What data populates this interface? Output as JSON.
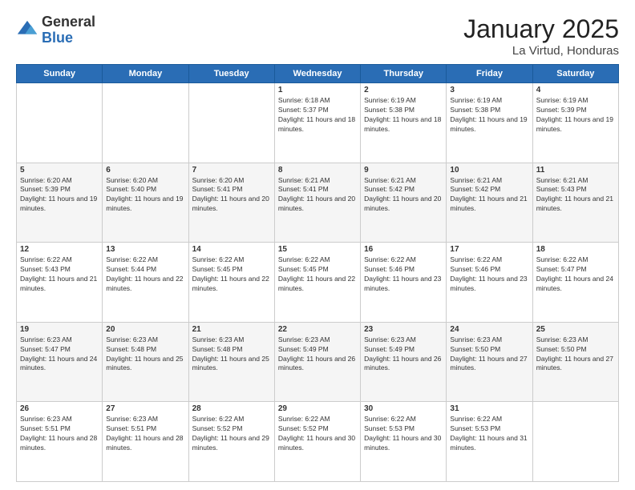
{
  "header": {
    "logo_general": "General",
    "logo_blue": "Blue",
    "month_title": "January 2025",
    "location": "La Virtud, Honduras"
  },
  "weekdays": [
    "Sunday",
    "Monday",
    "Tuesday",
    "Wednesday",
    "Thursday",
    "Friday",
    "Saturday"
  ],
  "weeks": [
    [
      {
        "day": "",
        "sunrise": "",
        "sunset": "",
        "daylight": ""
      },
      {
        "day": "",
        "sunrise": "",
        "sunset": "",
        "daylight": ""
      },
      {
        "day": "",
        "sunrise": "",
        "sunset": "",
        "daylight": ""
      },
      {
        "day": "1",
        "sunrise": "6:18 AM",
        "sunset": "5:37 PM",
        "daylight": "11 hours and 18 minutes."
      },
      {
        "day": "2",
        "sunrise": "6:19 AM",
        "sunset": "5:38 PM",
        "daylight": "11 hours and 18 minutes."
      },
      {
        "day": "3",
        "sunrise": "6:19 AM",
        "sunset": "5:38 PM",
        "daylight": "11 hours and 19 minutes."
      },
      {
        "day": "4",
        "sunrise": "6:19 AM",
        "sunset": "5:39 PM",
        "daylight": "11 hours and 19 minutes."
      }
    ],
    [
      {
        "day": "5",
        "sunrise": "6:20 AM",
        "sunset": "5:39 PM",
        "daylight": "11 hours and 19 minutes."
      },
      {
        "day": "6",
        "sunrise": "6:20 AM",
        "sunset": "5:40 PM",
        "daylight": "11 hours and 19 minutes."
      },
      {
        "day": "7",
        "sunrise": "6:20 AM",
        "sunset": "5:41 PM",
        "daylight": "11 hours and 20 minutes."
      },
      {
        "day": "8",
        "sunrise": "6:21 AM",
        "sunset": "5:41 PM",
        "daylight": "11 hours and 20 minutes."
      },
      {
        "day": "9",
        "sunrise": "6:21 AM",
        "sunset": "5:42 PM",
        "daylight": "11 hours and 20 minutes."
      },
      {
        "day": "10",
        "sunrise": "6:21 AM",
        "sunset": "5:42 PM",
        "daylight": "11 hours and 21 minutes."
      },
      {
        "day": "11",
        "sunrise": "6:21 AM",
        "sunset": "5:43 PM",
        "daylight": "11 hours and 21 minutes."
      }
    ],
    [
      {
        "day": "12",
        "sunrise": "6:22 AM",
        "sunset": "5:43 PM",
        "daylight": "11 hours and 21 minutes."
      },
      {
        "day": "13",
        "sunrise": "6:22 AM",
        "sunset": "5:44 PM",
        "daylight": "11 hours and 22 minutes."
      },
      {
        "day": "14",
        "sunrise": "6:22 AM",
        "sunset": "5:45 PM",
        "daylight": "11 hours and 22 minutes."
      },
      {
        "day": "15",
        "sunrise": "6:22 AM",
        "sunset": "5:45 PM",
        "daylight": "11 hours and 22 minutes."
      },
      {
        "day": "16",
        "sunrise": "6:22 AM",
        "sunset": "5:46 PM",
        "daylight": "11 hours and 23 minutes."
      },
      {
        "day": "17",
        "sunrise": "6:22 AM",
        "sunset": "5:46 PM",
        "daylight": "11 hours and 23 minutes."
      },
      {
        "day": "18",
        "sunrise": "6:22 AM",
        "sunset": "5:47 PM",
        "daylight": "11 hours and 24 minutes."
      }
    ],
    [
      {
        "day": "19",
        "sunrise": "6:23 AM",
        "sunset": "5:47 PM",
        "daylight": "11 hours and 24 minutes."
      },
      {
        "day": "20",
        "sunrise": "6:23 AM",
        "sunset": "5:48 PM",
        "daylight": "11 hours and 25 minutes."
      },
      {
        "day": "21",
        "sunrise": "6:23 AM",
        "sunset": "5:48 PM",
        "daylight": "11 hours and 25 minutes."
      },
      {
        "day": "22",
        "sunrise": "6:23 AM",
        "sunset": "5:49 PM",
        "daylight": "11 hours and 26 minutes."
      },
      {
        "day": "23",
        "sunrise": "6:23 AM",
        "sunset": "5:49 PM",
        "daylight": "11 hours and 26 minutes."
      },
      {
        "day": "24",
        "sunrise": "6:23 AM",
        "sunset": "5:50 PM",
        "daylight": "11 hours and 27 minutes."
      },
      {
        "day": "25",
        "sunrise": "6:23 AM",
        "sunset": "5:50 PM",
        "daylight": "11 hours and 27 minutes."
      }
    ],
    [
      {
        "day": "26",
        "sunrise": "6:23 AM",
        "sunset": "5:51 PM",
        "daylight": "11 hours and 28 minutes."
      },
      {
        "day": "27",
        "sunrise": "6:23 AM",
        "sunset": "5:51 PM",
        "daylight": "11 hours and 28 minutes."
      },
      {
        "day": "28",
        "sunrise": "6:22 AM",
        "sunset": "5:52 PM",
        "daylight": "11 hours and 29 minutes."
      },
      {
        "day": "29",
        "sunrise": "6:22 AM",
        "sunset": "5:52 PM",
        "daylight": "11 hours and 30 minutes."
      },
      {
        "day": "30",
        "sunrise": "6:22 AM",
        "sunset": "5:53 PM",
        "daylight": "11 hours and 30 minutes."
      },
      {
        "day": "31",
        "sunrise": "6:22 AM",
        "sunset": "5:53 PM",
        "daylight": "11 hours and 31 minutes."
      },
      {
        "day": "",
        "sunrise": "",
        "sunset": "",
        "daylight": ""
      }
    ]
  ],
  "labels": {
    "sunrise_prefix": "Sunrise: ",
    "sunset_prefix": "Sunset: ",
    "daylight_prefix": "Daylight: "
  }
}
